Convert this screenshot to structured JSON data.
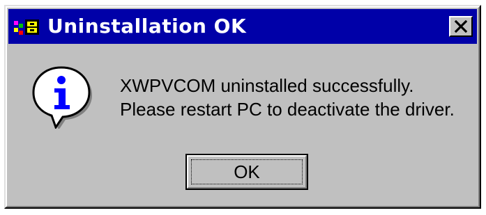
{
  "window": {
    "title": "Uninstallation OK",
    "title_bar_color": "#0000a8",
    "face_color": "#c0c0c0",
    "app_icon": "app-icon",
    "close_icon": "close-icon"
  },
  "dialog": {
    "icon": "info-icon",
    "message_lines": [
      "XWPVCOM uninstalled successfully.",
      "Please restart PC to deactivate the driver."
    ],
    "ok_label": "OK"
  }
}
